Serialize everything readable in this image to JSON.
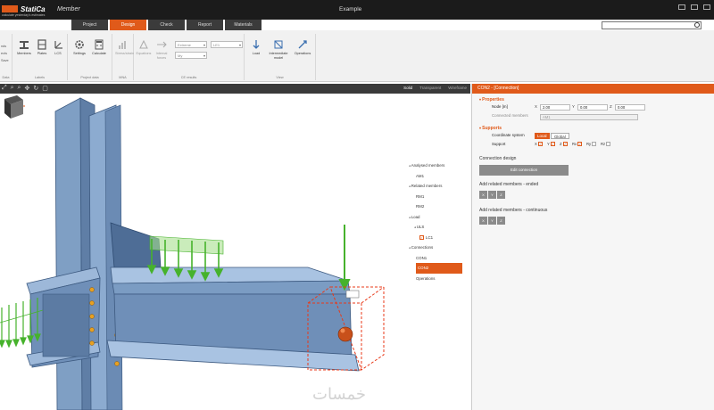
{
  "titlebar": {
    "logo_text": "StatiCa",
    "tagline": "calculate yesterday's estimates",
    "app_name": "Member",
    "document_title": "Example"
  },
  "tabs": [
    {
      "label": "Project",
      "active": false
    },
    {
      "label": "Design",
      "active": true
    },
    {
      "label": "Check",
      "active": false
    },
    {
      "label": "Report",
      "active": false
    },
    {
      "label": "Materials",
      "active": false
    }
  ],
  "ribbon": {
    "left_cut": [
      "nds",
      "ects",
      "Save"
    ],
    "groups": [
      {
        "label": "Data"
      },
      {
        "label": "Labels",
        "buttons": [
          "Members",
          "Plates",
          "LCS"
        ]
      },
      {
        "label": "Project data",
        "buttons": [
          "Settings",
          "Calculate"
        ]
      },
      {
        "label": "MNA",
        "buttons": [
          "Stress/strain"
        ]
      },
      {
        "label": "CE results",
        "buttons": [
          "Equations",
          "Internal forces"
        ],
        "dropdowns": [
          "Extreme",
          "My",
          "LE1"
        ]
      },
      {
        "label": "View",
        "buttons": [
          "Load",
          "Intermediate model",
          "Operations"
        ]
      }
    ]
  },
  "viewport": {
    "modes": [
      "Solid",
      "Transparent",
      "Wireframe"
    ],
    "active_mode": "Solid"
  },
  "tree": {
    "analysed_members": "Analysed members",
    "am1": "AM1",
    "related_members": "Related members",
    "rm1": "RM1",
    "rm2": "RM2",
    "load": "Load",
    "uls": "ULS",
    "lc1": "LC1",
    "connections": "Connections",
    "con1": "CON1",
    "con2": "CON2",
    "operations": "Operations"
  },
  "panel": {
    "header": "CON2 - [Connection]",
    "properties": "Properties",
    "node_label": "Node [m]",
    "x_label": "X",
    "x_value": "2.00",
    "y_label": "Y",
    "y_value": "0.00",
    "z_label": "Z",
    "z_value": "0.00",
    "connected_members_label": "Connected members",
    "connected_members_value": "AM1",
    "supports": "Supports",
    "coord_label": "Coordinate system",
    "coord_local": "Local",
    "coord_global": "Global",
    "support_label": "Support",
    "support_items": [
      {
        "name": "X",
        "checked": true
      },
      {
        "name": "Y",
        "checked": true
      },
      {
        "name": "Z",
        "checked": true
      },
      {
        "name": "Rx",
        "checked": true
      },
      {
        "name": "Ry",
        "checked": false
      },
      {
        "name": "Rz",
        "checked": false
      }
    ],
    "connection_design": "Connection design",
    "edit_connection": "Edit connection",
    "add_ended": "Add related members - ended",
    "add_continuous": "Add related members - continuous",
    "axis_buttons": [
      "X",
      "Y",
      "Z"
    ]
  },
  "colors": {
    "accent": "#e05a1a",
    "steel": "#6f8fb5",
    "load": "#3ba52a"
  },
  "watermark": "خمسات"
}
